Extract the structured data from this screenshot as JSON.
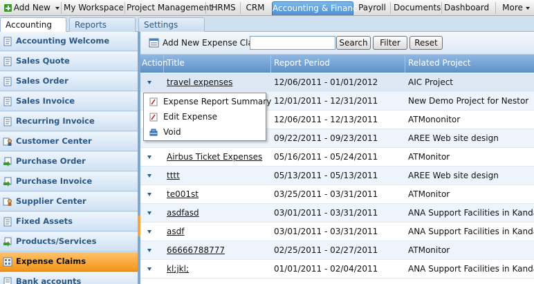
{
  "top_nav": {
    "add_new_label": "Add New",
    "tabs": [
      "My Workspace",
      "Project Management",
      "HRMS",
      "CRM",
      "Accounting & Finance",
      "Payroll",
      "Documents",
      "Dashboard",
      "More"
    ],
    "active_tab": "Accounting & Finance"
  },
  "sub_nav": {
    "tabs": [
      "Accounting",
      "Reports",
      "Settings"
    ],
    "active_tab": "Accounting"
  },
  "sidebar": {
    "items": [
      {
        "label": "Accounting Welcome",
        "icon": "doc-icon"
      },
      {
        "label": "Sales Quote",
        "icon": "doc-icon"
      },
      {
        "label": "Sales Order",
        "icon": "doc-icon"
      },
      {
        "label": "Sales Invoice",
        "icon": "doc-icon"
      },
      {
        "label": "Recurring Invoice",
        "icon": "doc-icon"
      },
      {
        "label": "Customer Center",
        "icon": "customer-icon"
      },
      {
        "label": "Purchase Order",
        "icon": "purchase-icon"
      },
      {
        "label": "Purchase Invoice",
        "icon": "purchase-icon"
      },
      {
        "label": "Supplier Center",
        "icon": "supplier-icon"
      },
      {
        "label": "Fixed Assets",
        "icon": "doc-icon"
      },
      {
        "label": "Products/Services",
        "icon": "purchase-icon"
      },
      {
        "label": "Expense Claims",
        "icon": "expense-icon"
      },
      {
        "label": "Bank accounts",
        "icon": "doc-icon"
      }
    ],
    "active_item": "Expense Claims"
  },
  "toolbar": {
    "add_label": "Add New Expense Claim",
    "search_value": "",
    "search_button": "Search",
    "filter_button": "Filter",
    "reset_button": "Reset"
  },
  "grid": {
    "headers": {
      "action": "Action",
      "title": "Title",
      "period": "Report Period",
      "project": "Related Project"
    },
    "rows": [
      {
        "title": "travel expenses",
        "period": "12/06/2011 - 01/01/2012",
        "project": "AIC Project"
      },
      {
        "title": "",
        "period": "12/01/2011 - 12/31/2011",
        "project": "New Demo Project for Nestor"
      },
      {
        "title": "",
        "period": "12/06/2011 - 12/13/2011",
        "project": "ATMononitor"
      },
      {
        "title": "",
        "period": "09/22/2011 - 09/23/2011",
        "project": "AREE Web site design"
      },
      {
        "title": "Airbus Ticket Expenses",
        "period": "05/16/2011 - 05/24/2011",
        "project": "ATMonitor"
      },
      {
        "title": "tttt",
        "period": "05/13/2011 - 05/13/2011",
        "project": "AREE Web site design"
      },
      {
        "title": "te001st",
        "period": "03/25/2011 - 03/31/2011",
        "project": "ATMonitor"
      },
      {
        "title": "asdfasd",
        "period": "03/01/2011 - 03/31/2011",
        "project": "ANA Support Facilities in Kandak Afgha"
      },
      {
        "title": "asdf",
        "period": "03/01/2011 - 03/31/2011",
        "project": "ANA Support Facilities in Kandak Afgha"
      },
      {
        "title": "66666788777",
        "period": "02/25/2011 - 02/27/2011",
        "project": "ATMonitor"
      },
      {
        "title": "kl;jkl;",
        "period": "01/01/2011 - 02/04/2011",
        "project": "ANA Support Facilities in Kandak Afgha"
      }
    ]
  },
  "context_menu": {
    "items": [
      {
        "label": "Expense Report Summary",
        "icon": "report-icon"
      },
      {
        "label": "Edit Expense",
        "icon": "edit-icon"
      },
      {
        "label": "Void",
        "icon": "void-icon"
      }
    ]
  },
  "colors": {
    "active_tab": "#4c8fd0",
    "active_sidebar": "#f3951a",
    "grid_header": "#6f9fd2"
  }
}
